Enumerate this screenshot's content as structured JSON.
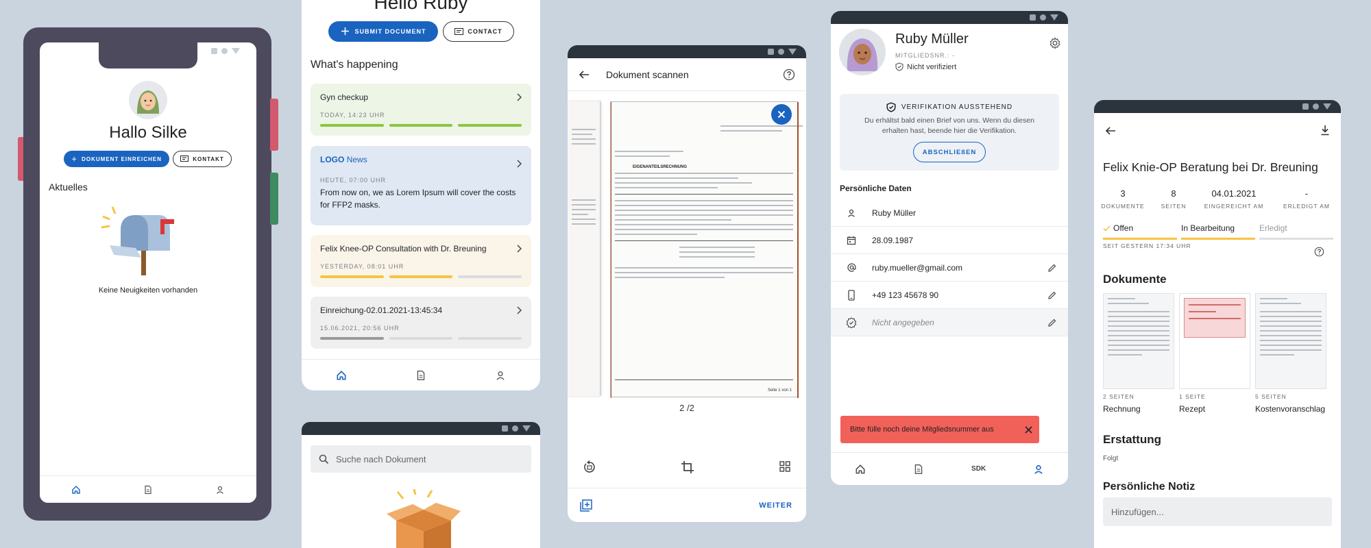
{
  "phone1": {
    "greeting": "Hallo Silke",
    "primary_button": "DOKUMENT EINREICHEN",
    "secondary_button": "KONTAKT",
    "section_title": "Aktuelles",
    "empty_text": "Keine Neuigkeiten vorhanden",
    "nav": [
      "home-icon",
      "document-icon",
      "person-icon"
    ]
  },
  "panel2": {
    "greeting": "Hello Ruby",
    "primary_button": "SUBMIT DOCUMENT",
    "secondary_button": "CONTACT",
    "section_title": "What's happening",
    "cards": [
      {
        "title": "Gyn checkup",
        "date": "TODAY, 14:23 UHR",
        "progress_done": 3,
        "progress_total": 3,
        "color": "#8cc540",
        "bg": "#edf5e6"
      },
      {
        "title_logo": "LOGO",
        "title": "News",
        "date": "HEUTE, 07:00 UHR",
        "body": "From now on, we as Lorem Ipsum will cover the costs for FFP2 masks.",
        "bg": "#dfe8f3"
      },
      {
        "title": "Felix Knee-OP Consultation with Dr. Breuning",
        "date": "YESTERDAY, 08:01 UHR",
        "progress_done": 2,
        "progress_total": 3,
        "color": "#f6c343",
        "bg": "#fbf4e8"
      },
      {
        "title": "Einreichung-02.01.2021-13:45:34",
        "date": "15.06.2021, 20:56 UHR",
        "progress_done": 1,
        "progress_total": 3,
        "color": "#9a9a9a",
        "bg": "#efefef"
      }
    ],
    "nav": [
      "home-icon",
      "document-icon",
      "person-icon"
    ]
  },
  "panel3": {
    "search_placeholder": "Suche nach Dokument"
  },
  "panel4": {
    "title": "Dokument scannen",
    "page_counter": "2 /2",
    "doc_heading": "EIGENANTEILSRECHNUNG",
    "doc_footer": "Seite 1 von 1",
    "next_button": "WEITER"
  },
  "panel5": {
    "name": "Ruby Müller",
    "member_label": "MITGLIEDSNR.: -",
    "verify_status": "Nicht verifiziert",
    "banner_title": "VERIFIKATION AUSSTEHEND",
    "banner_text": "Du erhältst bald einen Brief von uns. Wenn du diesen erhalten hast, beende hier die Verifikation.",
    "banner_button": "ABSCHLIEßEN",
    "section_title": "Persönliche Daten",
    "fields": [
      {
        "icon": "person-icon",
        "value": "Ruby Müller",
        "editable": false
      },
      {
        "icon": "calendar-icon",
        "value": "28.09.1987",
        "editable": false
      },
      {
        "icon": "at-icon",
        "value": "ruby.mueller@gmail.com",
        "editable": true
      },
      {
        "icon": "phone-icon",
        "value": "+49 123 45678 90",
        "editable": true
      },
      {
        "icon": "verified-icon",
        "value": "Nicht angegeben",
        "editable": true
      }
    ],
    "snackbar": "Bitte fülle noch deine Mitgliedsnummer aus",
    "snackbar_color": "#f2605a",
    "nav": [
      "home-icon",
      "document-icon",
      "SDK",
      "person-icon"
    ]
  },
  "panel6": {
    "title": "Felix Knie-OP Beratung bei Dr. Breuning",
    "stats": [
      {
        "value": "3",
        "label": "DOKUMENTE"
      },
      {
        "value": "8",
        "label": "SEITEN"
      },
      {
        "value": "04.01.2021",
        "label": "EINGEREICHT AM"
      },
      {
        "value": "-",
        "label": "ERLEDIGT AM"
      }
    ],
    "steps": [
      "Offen",
      "In Bearbeitung",
      "Erledigt"
    ],
    "since": "SEIT GESTERN 17:34 UHR",
    "documents_title": "Dokumente",
    "documents": [
      {
        "pages": "2 SEITEN",
        "name": "Rechnung"
      },
      {
        "pages": "1 SEITE",
        "name": "Rezept"
      },
      {
        "pages": "5 SEITEN",
        "name": "Kostenvoranschlag"
      }
    ],
    "refund_title": "Erstattung",
    "refund_value": "Folgt",
    "note_title": "Persönliche Notiz",
    "note_placeholder": "Hinzufügen..."
  },
  "colors": {
    "primary": "#1a64c0",
    "background": "#c9d4de",
    "statusbar": "#2b333d",
    "progress_yellow": "#f6c343",
    "progress_green": "#8cc540"
  }
}
